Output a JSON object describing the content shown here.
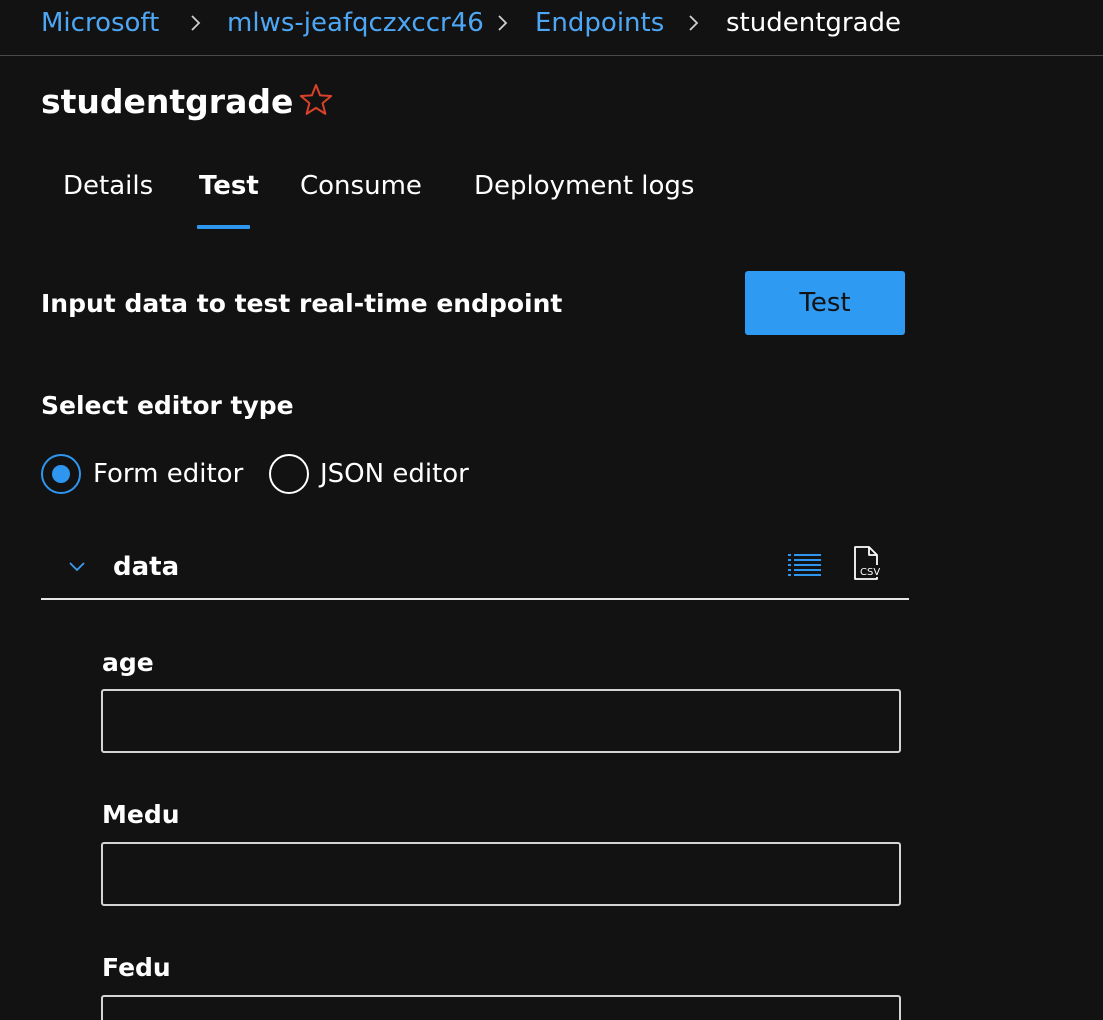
{
  "breadcrumb": {
    "items": [
      "Microsoft",
      "mlws-jeafqczxccr46",
      "Endpoints"
    ],
    "current": "studentgrade"
  },
  "page": {
    "title": "studentgrade",
    "favorite_icon": "star-outline-icon"
  },
  "tabs": [
    {
      "label": "Details",
      "active": false
    },
    {
      "label": "Test",
      "active": true
    },
    {
      "label": "Consume",
      "active": false
    },
    {
      "label": "Deployment logs",
      "active": false
    }
  ],
  "test_section": {
    "title": "Input data to test real-time endpoint",
    "button_label": "Test"
  },
  "editor": {
    "label": "Select editor type",
    "options": [
      {
        "label": "Form editor",
        "selected": true
      },
      {
        "label": "JSON editor",
        "selected": false
      }
    ]
  },
  "data_group": {
    "title": "data",
    "expanded": true,
    "icons": [
      "list-view-icon",
      "csv-file-icon"
    ]
  },
  "fields": [
    {
      "label": "age",
      "value": ""
    },
    {
      "label": "Medu",
      "value": ""
    },
    {
      "label": "Fedu",
      "value": ""
    }
  ],
  "colors": {
    "accent": "#2f96f0",
    "link": "#4ea7f5",
    "favorite": "#d9422b",
    "background": "#121212"
  }
}
